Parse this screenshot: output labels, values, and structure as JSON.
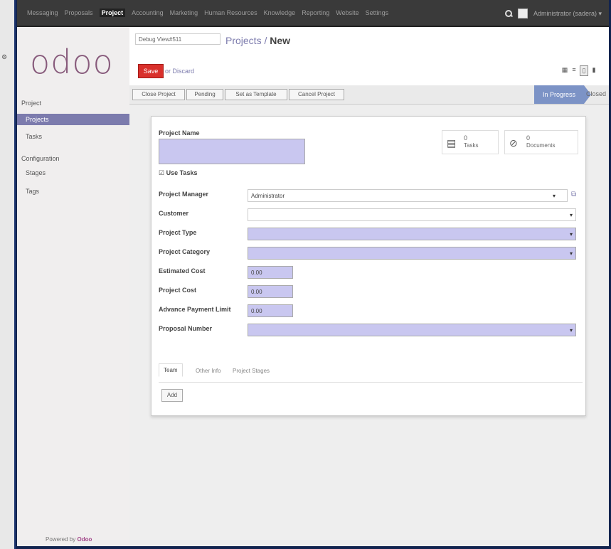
{
  "topbar": {
    "menu": [
      "Messaging",
      "Proposals",
      "Project",
      "Accounting",
      "Marketing",
      "Human Resources",
      "Knowledge",
      "Reporting",
      "Website",
      "Settings"
    ],
    "active_index": 2,
    "user": "Administrator (sadera) ▾"
  },
  "sidebar": {
    "logo": "odoo",
    "section_project": "Project",
    "items_project": [
      "Projects",
      "Tasks"
    ],
    "section_config": "Configuration",
    "items_config": [
      "Stages",
      "Tags"
    ],
    "powered_by": "Powered by",
    "powered_brand": "Odoo"
  },
  "control": {
    "debug_select": "Debug View#511",
    "breadcrumb_parent": "Projects",
    "breadcrumb_sep": " / ",
    "breadcrumb_current": "New",
    "save_label": "Save",
    "discard_label": "or Discard"
  },
  "statusbar": {
    "buttons": [
      "Close Project",
      "Pending",
      "Set as Template",
      "Cancel Project"
    ],
    "stage_active": "In Progress",
    "stage_next": "Closed"
  },
  "form": {
    "project_name_label": "Project Name",
    "use_tasks_label": "Use Tasks",
    "stat_tasks_value": "0",
    "stat_tasks_label": "Tasks",
    "stat_docs_value": "0",
    "stat_docs_label": "Documents",
    "fields": [
      {
        "label": "Project Manager",
        "value": "Administrator"
      },
      {
        "label": "Customer",
        "value": ""
      },
      {
        "label": "Project Type",
        "value": ""
      },
      {
        "label": "Project Category",
        "value": ""
      },
      {
        "label": "Estimated Cost",
        "value": "0.00"
      },
      {
        "label": "Project Cost",
        "value": "0.00"
      },
      {
        "label": "Advance Payment Limit",
        "value": "0.00"
      },
      {
        "label": "Proposal Number",
        "value": ""
      }
    ],
    "tabs": [
      "Team",
      "Other Info",
      "Project Stages"
    ],
    "add_label": "Add"
  },
  "colors": {
    "accent": "#7c7bad",
    "save": "#d9302c",
    "required_field": "#c9c7f0"
  }
}
